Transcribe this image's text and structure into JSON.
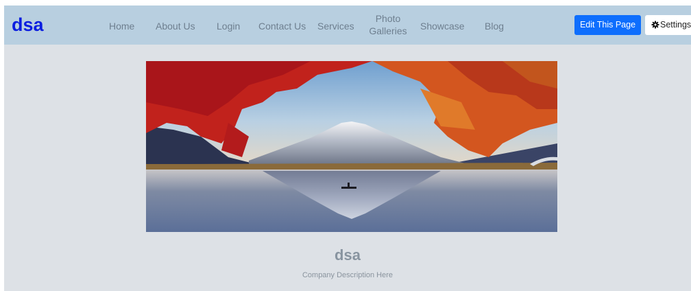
{
  "navbar": {
    "brand": "dsa",
    "links": [
      {
        "label": "Home"
      },
      {
        "label": "About Us"
      },
      {
        "label": "Login"
      },
      {
        "label": "Contact Us"
      },
      {
        "label": "Services"
      },
      {
        "label_line1": "Photo",
        "label_line2": "Galleries"
      },
      {
        "label": "Showcase"
      },
      {
        "label": "Blog"
      }
    ],
    "edit_button": "Edit This Page",
    "settings_button": "Settings",
    "settings_icon": "gear-icon"
  },
  "hero": {
    "image": "autumn-lake-mountain-photo"
  },
  "site": {
    "title": "dsa",
    "description": "Company Description Here"
  },
  "colors": {
    "navbar_bg": "#b8cfe0",
    "page_bg": "#dde1e6",
    "brand": "#0b1ee0",
    "primary_button": "#0d6efd"
  }
}
